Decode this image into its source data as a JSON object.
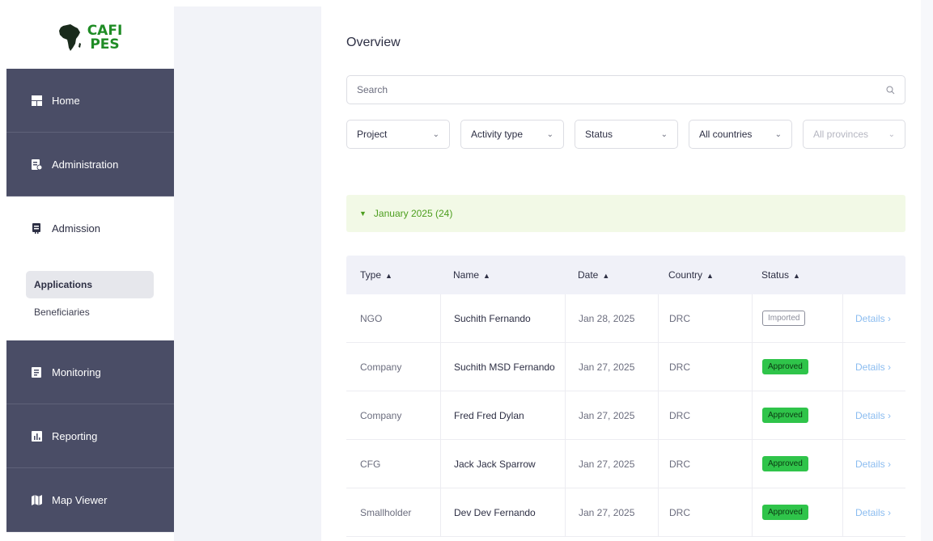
{
  "logo": {
    "line1": "CAFI",
    "line2": "PES"
  },
  "nav": {
    "home": "Home",
    "administration": "Administration",
    "admission": "Admission",
    "sub": {
      "applications": "Applications",
      "beneficiaries": "Beneficiaries"
    },
    "monitoring": "Monitoring",
    "reporting": "Reporting",
    "map_viewer": "Map Viewer"
  },
  "main": {
    "title": "Overview",
    "search": {
      "placeholder": "Search"
    },
    "filters": {
      "project": "Project",
      "activity_type": "Activity type",
      "status": "Status",
      "countries": "All countries",
      "provinces": "All provinces"
    },
    "group": {
      "label": "January 2025 (24)"
    },
    "table": {
      "headers": {
        "type": "Type",
        "name": "Name",
        "date": "Date",
        "country": "Country",
        "status": "Status"
      },
      "rows": [
        {
          "type": "NGO",
          "name": "Suchith Fernando",
          "date": "Jan 28, 2025",
          "country": "DRC",
          "status": "Imported",
          "action": "Details ›"
        },
        {
          "type": "Company",
          "name": "Suchith MSD Fernando",
          "date": "Jan 27, 2025",
          "country": "DRC",
          "status": "Approved",
          "action": "Details ›"
        },
        {
          "type": "Company",
          "name": "Fred Fred Dylan",
          "date": "Jan 27, 2025",
          "country": "DRC",
          "status": "Approved",
          "action": "Details ›"
        },
        {
          "type": "CFG",
          "name": "Jack Jack Sparrow",
          "date": "Jan 27, 2025",
          "country": "DRC",
          "status": "Approved",
          "action": "Details ›"
        },
        {
          "type": "Smallholder",
          "name": "Dev Dev Fernando",
          "date": "Jan 27, 2025",
          "country": "DRC",
          "status": "Approved",
          "action": "Details ›"
        }
      ]
    }
  },
  "colors": {
    "sidebar_dark": "#4a4d66",
    "brand_green": "#1f8c25",
    "approved_green": "#2fc44a",
    "group_bg": "#f2f9e6",
    "link_blue": "#8bbcf0"
  },
  "icons": {
    "logo": "africa-map-icon",
    "search": "search-icon",
    "home": "home-icon",
    "administration": "admin-file-icon",
    "admission": "admission-icon",
    "monitoring": "monitoring-icon",
    "reporting": "chart-icon",
    "map_viewer": "map-icon"
  }
}
